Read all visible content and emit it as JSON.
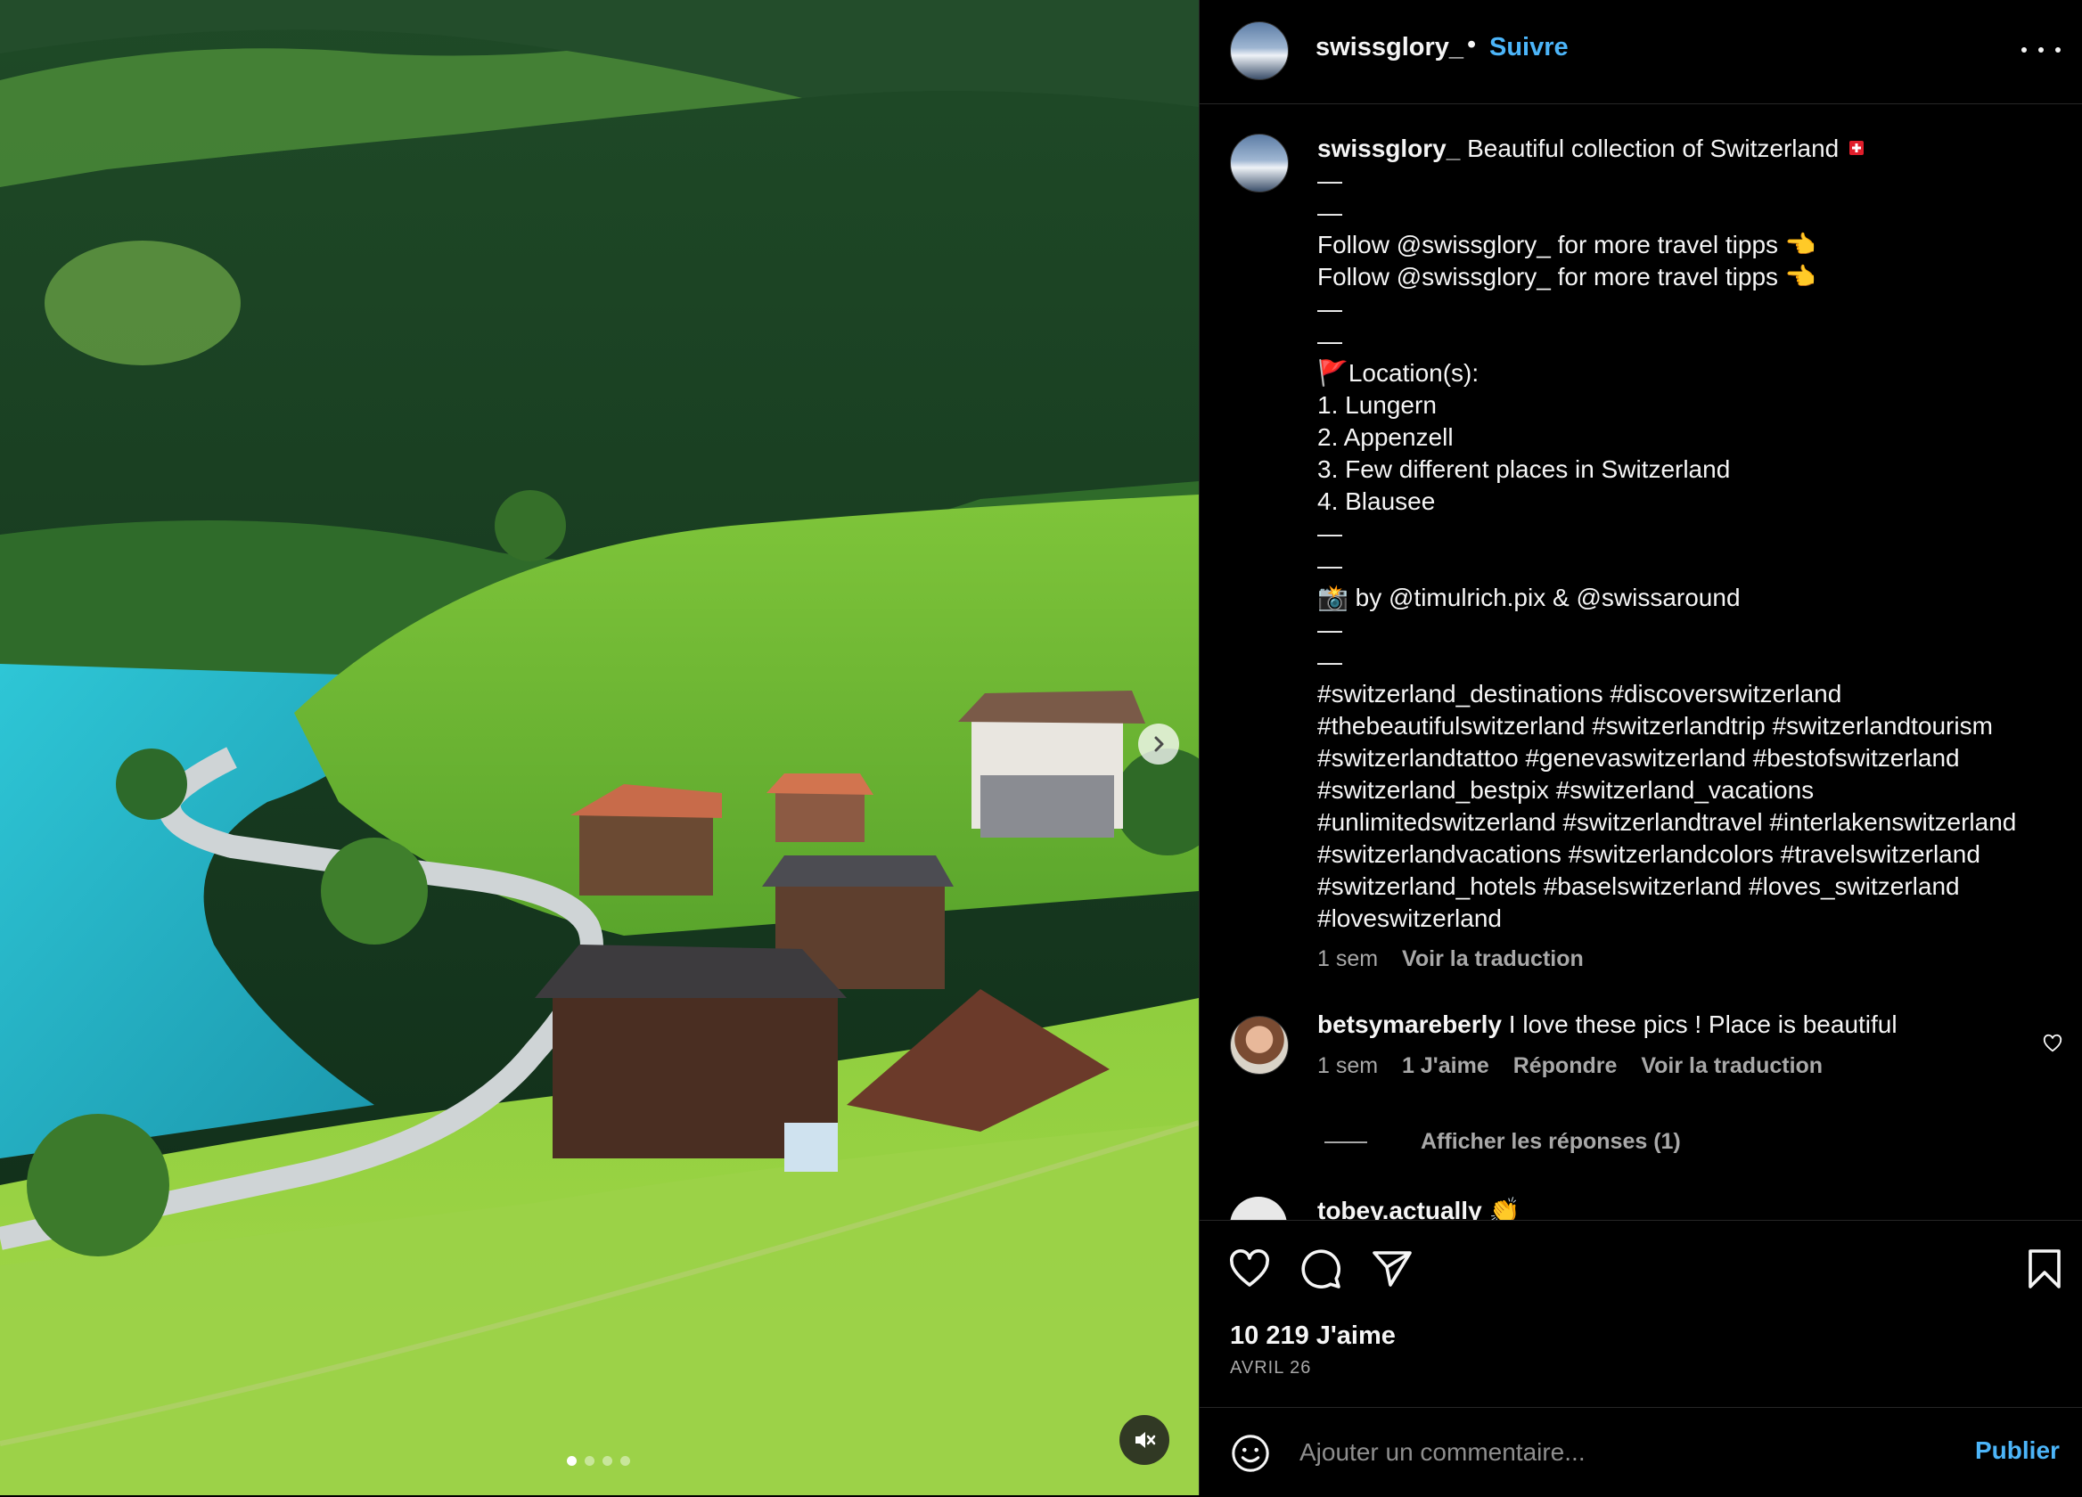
{
  "post": {
    "username": "swissglory_",
    "bullet": "•",
    "follow_label": "Suivre",
    "more_icon": "more-horizontal-icon"
  },
  "caption": {
    "username": "swissglory_",
    "title": "Beautiful collection of Switzerland",
    "flag_icon": "swiss-flag-icon",
    "lines": [
      "—",
      "—",
      "Follow @swissglory_ for more travel tipps 👈",
      "Follow @swissglory_ for more travel tipps 👈",
      "—",
      "—",
      "🚩Location(s):",
      "1. Lungern",
      "2. Appenzell",
      "3. Few different places in Switzerland",
      "4. Blausee",
      "—",
      "—",
      "📸 by @timulrich.pix & @swissaround",
      "—",
      "—"
    ],
    "hashtags": "#switzerland_destinations #discoverswitzerland #thebeautifulswitzerland #switzerlandtrip #switzerlandtourism #switzerlandtattoo #genevaswitzerland #bestofswitzerland #switzerland_bestpix #switzerland_vacations #unlimitedswitzerland #switzerlandtravel #interlakenswitzerland #switzerlandvacations #switzerlandcolors #travelswitzerland #switzerland_hotels #baselswitzerland #loves_switzerland #loveswitzerland",
    "age": "1 sem",
    "translate": "Voir la traduction"
  },
  "comments": [
    {
      "username": "betsymareberly",
      "text": "I love these pics ! Place is beautiful",
      "age": "1 sem",
      "likes": "1 J'aime",
      "reply": "Répondre",
      "translate": "Voir la traduction",
      "replies_label": "Afficher les réponses (1)"
    },
    {
      "username": "tobey.actually",
      "emoji": "👏"
    }
  ],
  "actions": {
    "like_icon": "heart-icon",
    "comment_icon": "comment-icon",
    "share_icon": "send-icon",
    "save_icon": "bookmark-icon"
  },
  "stats": {
    "likes": "10 219 J'aime",
    "date": "AVRIL 26"
  },
  "add_comment": {
    "placeholder": "Ajouter un commentaire...",
    "publish": "Publier"
  },
  "media": {
    "carousel_count": 4,
    "carousel_active": 1
  },
  "colors": {
    "accent": "#4cb5f9",
    "background": "#000000",
    "secondary_text": "#a8a8a8"
  }
}
